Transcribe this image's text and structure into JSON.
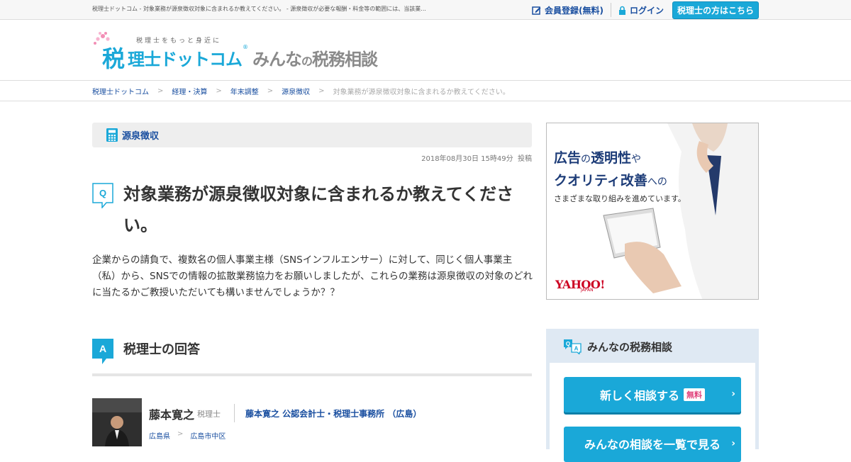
{
  "topbar": {
    "tagline": "税理士ドットコム - 対象業務が源泉徴収対象に含まれるか教えてください。 - 源泉徴収が必要な報酬・料金等の範囲には、当該業...",
    "register": "会員登録(無料)",
    "login": "ログイン",
    "pro_link": "税理士の方はこちら"
  },
  "logo": {
    "tagline": "税理士をもっと身近に",
    "zei": "税",
    "rest": "理士ドットコム",
    "registered": "®",
    "sub_a": "みんな",
    "sub_no": "の",
    "sub_b": "税務相談"
  },
  "breadcrumb": {
    "items": [
      "税理士ドットコム",
      "経理・決算",
      "年末調整",
      "源泉徴収"
    ],
    "current": "対象業務が源泉徴収対象に含まれるか教えてください。"
  },
  "category": {
    "label": "源泉徴収"
  },
  "question": {
    "date": "2018年08月30日 15時49分",
    "post_label": "投稿",
    "badge": "Q",
    "title": "対象業務が源泉徴収対象に含まれるか教えてください。",
    "body": "企業からの請負で、複数名の個人事業主様（SNSインフルエンサー）に対して、同じく個人事業主（私）から、SNSでの情報の拡散業務協力をお願いしましたが、これらの業務は源泉徴収の対象のどれに当たるかご教授いただいても構いませんでしょうか？？"
  },
  "answer": {
    "badge": "A",
    "heading": "税理士の回答",
    "name": "藤本寛之",
    "role": "税理士",
    "office": "藤本寛之 公認会計士・税理士事務所 （広島）",
    "pref": "広島県",
    "city": "広島市中区"
  },
  "ad": {
    "line1_a": "広告",
    "line1_b": "の",
    "line1_c": "透明性",
    "line1_d": "や",
    "line2_a": "クオリティ改善",
    "line2_b": "への",
    "line3": "さまざまな取り組みを進めています。",
    "brand": "YAHOO!",
    "brand_sub": "JAPAN"
  },
  "sidebar": {
    "heading": "みんなの税務相談",
    "new_button": "新しく相談する",
    "new_badge": "無料",
    "list_button": "みんなの相談を一覧で見る"
  },
  "colors": {
    "accent": "#1aa8d8",
    "link": "#1a4fa0",
    "ad_text": "#1d3c78"
  }
}
